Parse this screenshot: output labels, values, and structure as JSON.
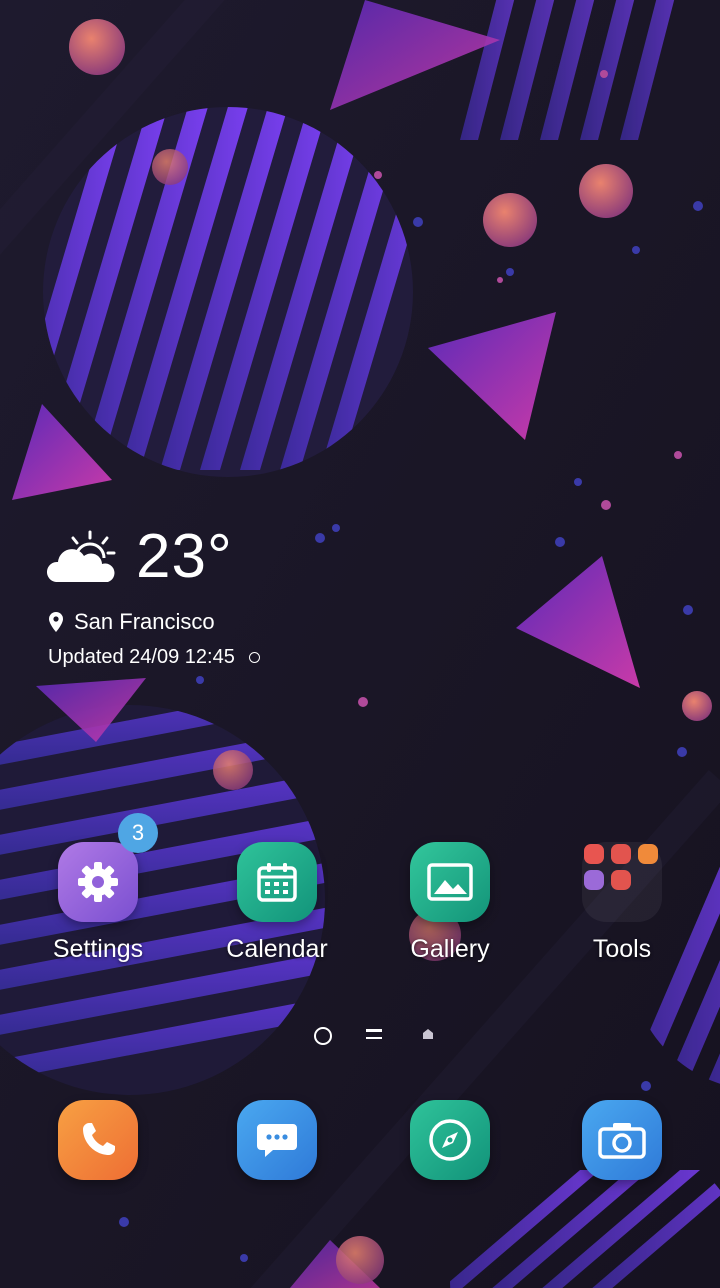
{
  "weather": {
    "temperature": "23°",
    "location": "San Francisco",
    "updated": "Updated 24/09 12:45",
    "icon": "partly-sunny-icon"
  },
  "apps": [
    {
      "label": "Settings",
      "icon": "gear-icon",
      "color": "#9b6ad8",
      "badge": "3"
    },
    {
      "label": "Calendar",
      "icon": "calendar-icon",
      "color": "#1fae8a"
    },
    {
      "label": "Gallery",
      "icon": "image-icon",
      "color": "#22b38c"
    },
    {
      "label": "Tools",
      "icon": "folder-icon"
    }
  ],
  "dock": [
    {
      "icon": "phone-icon",
      "color": "#f2853a"
    },
    {
      "icon": "message-icon",
      "color": "#3d8fe0"
    },
    {
      "icon": "compass-icon",
      "color": "#1fae8a"
    },
    {
      "icon": "camera-icon",
      "color": "#3a8de0"
    }
  ],
  "page_indicators": [
    "circle-icon",
    "list-icon",
    "home-icon"
  ]
}
